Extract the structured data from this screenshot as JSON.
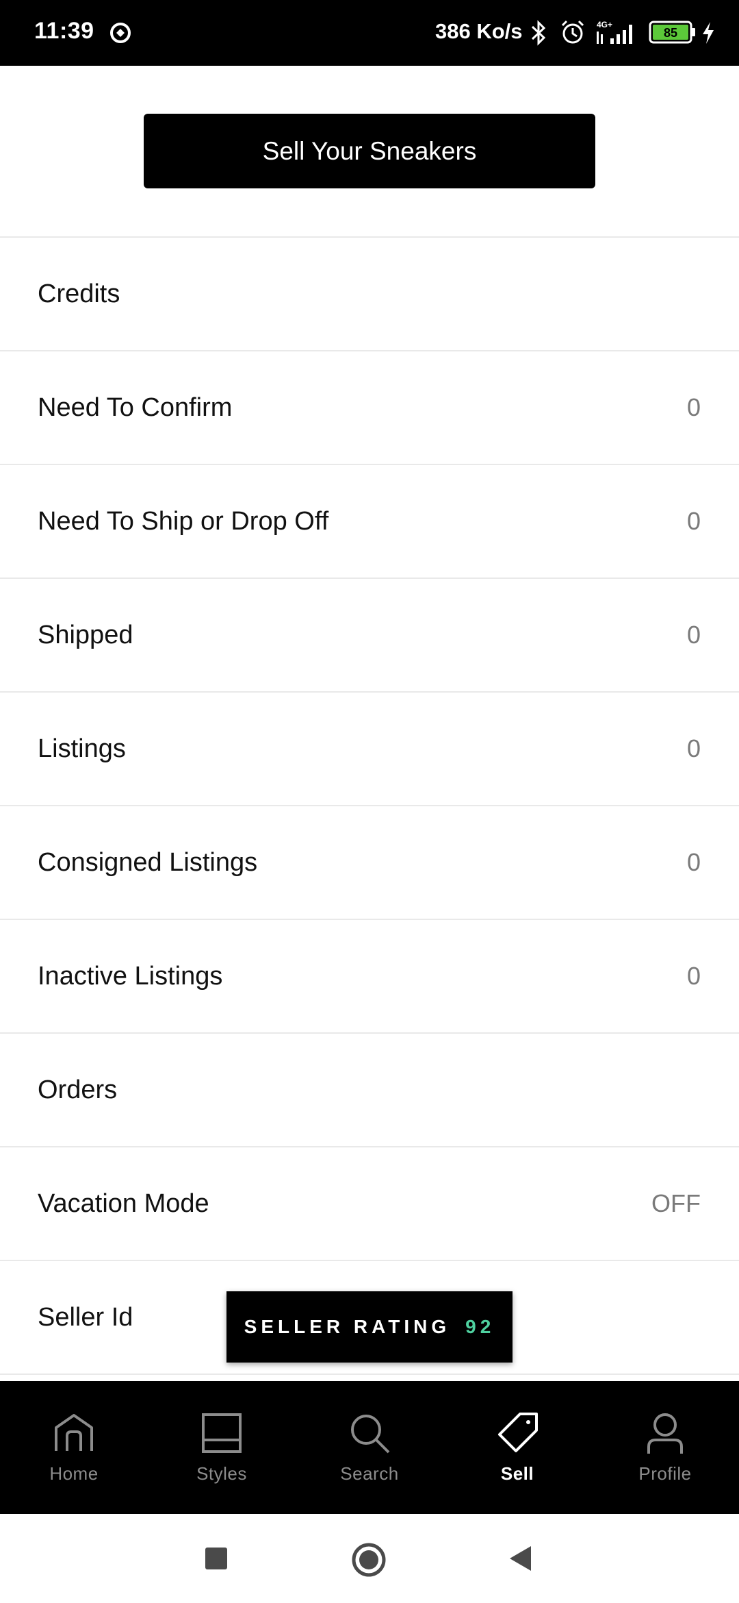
{
  "status_bar": {
    "time": "11:39",
    "network_speed": "386 Ko/s",
    "network_type": "4G+",
    "battery_level": "85",
    "icons": [
      "sync-icon",
      "bluetooth-icon",
      "alarm-icon",
      "signal-icon",
      "battery-icon",
      "charging-icon"
    ]
  },
  "sell_button": {
    "label": "Sell Your Sneakers"
  },
  "menu": {
    "items": [
      {
        "label": "Credits",
        "value": ""
      },
      {
        "label": "Need To Confirm",
        "value": "0"
      },
      {
        "label": "Need To Ship or Drop Off",
        "value": "0"
      },
      {
        "label": "Shipped",
        "value": "0"
      },
      {
        "label": "Listings",
        "value": "0"
      },
      {
        "label": "Consigned Listings",
        "value": "0"
      },
      {
        "label": "Inactive Listings",
        "value": "0"
      },
      {
        "label": "Orders",
        "value": ""
      },
      {
        "label": "Vacation Mode",
        "value": "OFF"
      },
      {
        "label": "Seller Id",
        "value": ""
      }
    ]
  },
  "seller_rating": {
    "label": "SELLER RATING",
    "value": "92",
    "accent_color": "#4fd1a0"
  },
  "bottom_nav": {
    "items": [
      {
        "label": "Home",
        "icon": "home-icon",
        "active": false
      },
      {
        "label": "Styles",
        "icon": "styles-icon",
        "active": false
      },
      {
        "label": "Search",
        "icon": "search-icon",
        "active": false
      },
      {
        "label": "Sell",
        "icon": "tag-icon",
        "active": true
      },
      {
        "label": "Profile",
        "icon": "profile-icon",
        "active": false
      }
    ]
  },
  "system_nav": {
    "buttons": [
      "recents-button",
      "home-button",
      "back-button"
    ]
  }
}
